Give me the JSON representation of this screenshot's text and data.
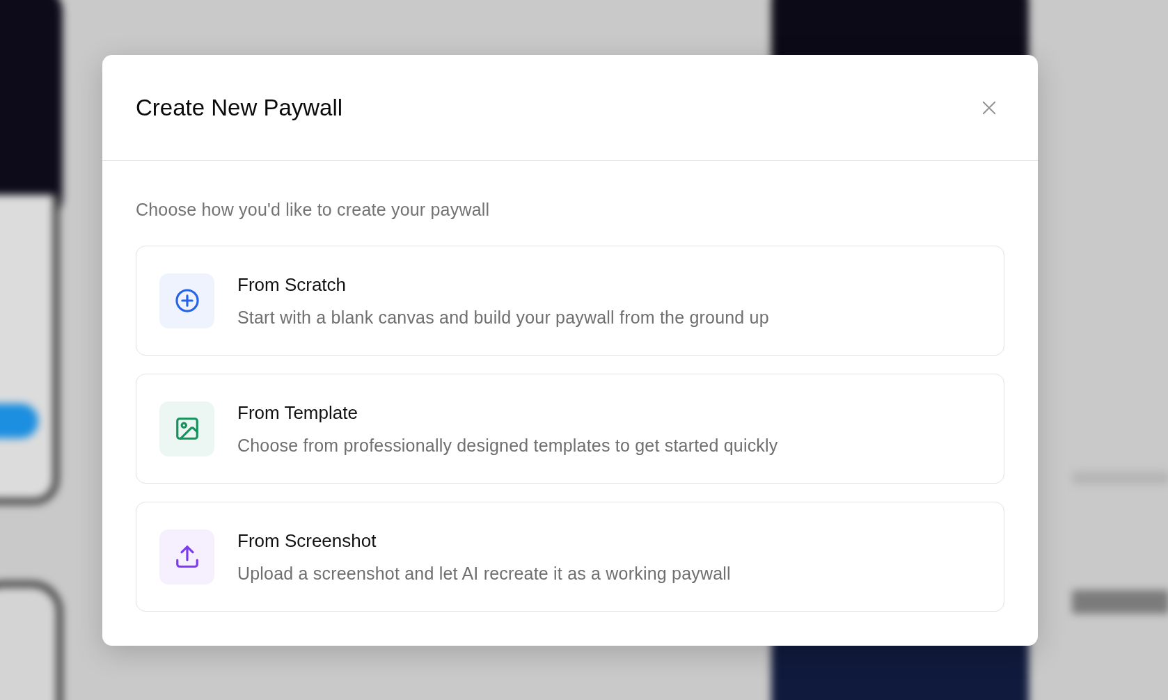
{
  "dialog": {
    "title": "Create New Paywall",
    "subtitle": "Choose how you'd like to create your paywall"
  },
  "options": [
    {
      "title": "From Scratch",
      "description": "Start with a blank canvas and build your paywall from the ground up",
      "color": "#2563eb"
    },
    {
      "title": "From Template",
      "description": "Choose from professionally designed templates to get started quickly",
      "color": "#16925d"
    },
    {
      "title": "From Screenshot",
      "description": "Upload a screenshot and let AI recreate it as a working paywall",
      "color": "#7c3aed"
    }
  ]
}
